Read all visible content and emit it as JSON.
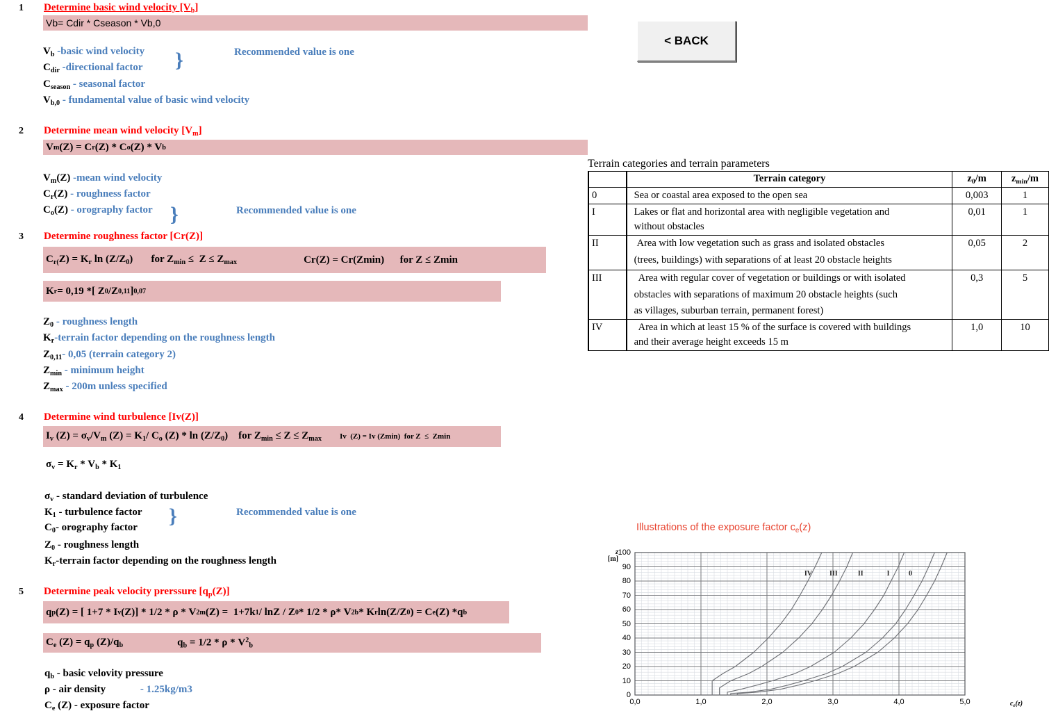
{
  "buttons": {
    "back": "< BACK"
  },
  "steps": [
    {
      "num": "1",
      "heading": "Determine basic wind velocity [Vb]",
      "formula": "Vb= Cdir * Cseason * Vb,0",
      "recommended": "Recommended value is one",
      "defs": [
        {
          "sym": "V",
          "sub": "b",
          "text": "-basic wind velocity"
        },
        {
          "sym": "C",
          "sub": "dir",
          "text": "-directional factor"
        },
        {
          "sym": "C",
          "sub": "season",
          "text": "- seasonal factor"
        },
        {
          "sym": "V",
          "sub": "b,0",
          "text": "- fundamental value of basic wind velocity"
        }
      ]
    },
    {
      "num": "2",
      "heading": "Determine mean wind velocity [Vm]",
      "formula": "Vm(Z) = Cr(Z) * Co(Z) * Vb",
      "recommended": "Recommended value is one",
      "defs": [
        {
          "sym": "V",
          "sub": "m",
          "rest": "(Z)",
          "text": "-mean wind velocity"
        },
        {
          "sym": "C",
          "sub": "r",
          "rest": "(Z)",
          "text": "- roughness factor"
        },
        {
          "sym": "C",
          "sub": "o",
          "rest": "(Z)",
          "text": "- orography factor"
        }
      ]
    },
    {
      "num": "3",
      "heading": "Determine roughness factor [Cr(Z)]",
      "formula_left": "Cr(Z) = Kr ln (Z/Z0)      for Zmin ≤  Z ≤ Zmax",
      "formula_right": "Cr(Z) = Cr(Zmin)      for Z ≤ Zmin",
      "formula2": "Kr = 0,19 *[ Z0/Z0,11]0,07",
      "defs": [
        {
          "sym": "Z",
          "sub": "0",
          "text": "- roughness length"
        },
        {
          "sym": "K",
          "sub": "r",
          "text": "-terrain factor depending on the roughness length"
        },
        {
          "sym": "Z",
          "sub": "0,11",
          "text": "- 0,05 (terrain category  2)"
        },
        {
          "sym": "Z",
          "sub": "min",
          "text": "- minimum height"
        },
        {
          "sym": "Z",
          "sub": "max",
          "text": "- 200m unless specified"
        }
      ]
    },
    {
      "num": "4",
      "heading": "Determine wind turbulence  [Iv(Z)]",
      "formula": "Iv (Z) = σv/Vm (Z) = K1/ Co (Z) * ln (Z/Z0)    for Zmin ≤ Z ≤ Zmax",
      "formula_small": "Iv  (Z) = Iv (Zmin)   for Z  ≤  Zmin",
      "formula2": "σv = Kr * Vb * K1",
      "recommended": "Recommended value is one",
      "defs": [
        {
          "sym": "σ",
          "sub": "v",
          "text": "- standard deviation of turbulence"
        },
        {
          "sym": "K",
          "sub": "1",
          "text": "- turbulence factor"
        },
        {
          "sym": "C",
          "sub": "0",
          "text": "- orography factor"
        },
        {
          "sym": "Z",
          "sub": "0",
          "text": "- roughness length"
        },
        {
          "sym": "K",
          "sub": "r",
          "text": "-terrain factor depending on the roughness length"
        }
      ]
    },
    {
      "num": "5",
      "heading": "Determine peak velocity prerssure [qp(Z)]",
      "formula": "qp (Z) = [ 1+7 * Iv (Z)] * 1/2 * ρ * V2m (Z) =  1+7k1/ lnZ / Z0 * 1/2 * ρ* V2b * Kr ln(Z/Z0) = Ce (Z) *qb",
      "formula2_left": "Ce (Z) = qp (Z)/qb",
      "formula2_right": "qb = 1/2 * ρ * V2b",
      "defs": [
        {
          "sym": "q",
          "sub": "b",
          "text": "- basic velovity pressure"
        },
        {
          "sym": "ρ",
          "sub": "",
          "text": "- air density",
          "value": "- 1.25kg/m3"
        },
        {
          "sym": "C",
          "sub": "e",
          "rest": " (Z)",
          "text": "- exposure factor"
        }
      ]
    }
  ],
  "terrain_table": {
    "title": "Terrain categories and terrain parameters",
    "headers": {
      "blank": "",
      "category": "Terrain category",
      "z0": "z0/m",
      "zmin": "zmin/m"
    },
    "rows": [
      {
        "cat": "0",
        "desc": [
          "Sea or coastal area exposed to the open sea"
        ],
        "z0": "0,003",
        "zmin": "1"
      },
      {
        "cat": "I",
        "desc": [
          "Lakes or flat and horizontal area with negligible vegetation and",
          "without obstacles"
        ],
        "z0": "0,01",
        "zmin": "1"
      },
      {
        "cat": "II",
        "desc": [
          "Area with low vegetation such as grass and isolated obstacles",
          "(trees, buildings) with separations of at least 20 obstacle heights"
        ],
        "z0": "0,05",
        "zmin": "2"
      },
      {
        "cat": "III",
        "desc": [
          "Area with regular cover of vegetation or buildings or with isolated",
          "obstacles with separations of maximum 20 obstacle heights (such",
          "as villages, suburban terrain, permanent forest)"
        ],
        "z0": "0,3",
        "zmin": "5"
      },
      {
        "cat": "IV",
        "desc": [
          "Area in which at least 15 % of the surface is covered with buildings",
          "and their average height exceeds 15 m"
        ],
        "z0": "1,0",
        "zmin": "10"
      }
    ]
  },
  "chart_data": {
    "type": "line",
    "title": "Illustrations of the exposure factor ce(z)",
    "xlabel": "ce(z)",
    "ylabel": "z [m]",
    "xlim": [
      0.0,
      5.0
    ],
    "ylim": [
      0,
      100
    ],
    "xticks": [
      "0,0",
      "1,0",
      "2,0",
      "3,0",
      "4,0",
      "5,0"
    ],
    "yticks": [
      "0",
      "10",
      "20",
      "30",
      "40",
      "50",
      "60",
      "70",
      "80",
      "90",
      "100"
    ],
    "grid": true,
    "legend_position": "inline-at-curve-top",
    "series": [
      {
        "name": "IV",
        "zmin": 10,
        "ce_at_zmin": 1.17,
        "points": [
          [
            1.17,
            0
          ],
          [
            1.17,
            10
          ],
          [
            1.33,
            15
          ],
          [
            1.52,
            20
          ],
          [
            1.8,
            30
          ],
          [
            2.02,
            40
          ],
          [
            2.21,
            50
          ],
          [
            2.37,
            60
          ],
          [
            2.5,
            70
          ],
          [
            2.62,
            80
          ],
          [
            2.73,
            90
          ],
          [
            2.83,
            100
          ]
        ]
      },
      {
        "name": "III",
        "zmin": 5,
        "ce_at_zmin": 1.28,
        "points": [
          [
            1.28,
            0
          ],
          [
            1.28,
            5
          ],
          [
            1.45,
            10
          ],
          [
            1.72,
            15
          ],
          [
            1.92,
            20
          ],
          [
            2.24,
            30
          ],
          [
            2.48,
            40
          ],
          [
            2.68,
            50
          ],
          [
            2.84,
            60
          ],
          [
            2.98,
            70
          ],
          [
            3.1,
            80
          ],
          [
            3.21,
            90
          ],
          [
            3.3,
            100
          ]
        ]
      },
      {
        "name": "II",
        "zmin": 2,
        "ce_at_zmin": 1.4,
        "points": [
          [
            1.4,
            0
          ],
          [
            1.4,
            2
          ],
          [
            1.6,
            4
          ],
          [
            1.85,
            7
          ],
          [
            2.08,
            10
          ],
          [
            2.42,
            15
          ],
          [
            2.66,
            20
          ],
          [
            3.02,
            30
          ],
          [
            3.27,
            40
          ],
          [
            3.47,
            50
          ],
          [
            3.63,
            60
          ],
          [
            3.77,
            70
          ],
          [
            3.88,
            80
          ],
          [
            3.99,
            90
          ],
          [
            4.08,
            100
          ]
        ]
      },
      {
        "name": "I",
        "zmin": 1,
        "ce_at_zmin": 1.45,
        "points": [
          [
            1.45,
            0
          ],
          [
            1.45,
            1
          ],
          [
            1.72,
            2
          ],
          [
            2.05,
            4
          ],
          [
            2.32,
            7
          ],
          [
            2.55,
            10
          ],
          [
            2.9,
            15
          ],
          [
            3.14,
            20
          ],
          [
            3.5,
            30
          ],
          [
            3.75,
            40
          ],
          [
            3.95,
            50
          ],
          [
            4.1,
            60
          ],
          [
            4.23,
            70
          ],
          [
            4.35,
            80
          ],
          [
            4.45,
            90
          ],
          [
            4.54,
            100
          ]
        ]
      },
      {
        "name": "0",
        "zmin": 1,
        "ce_at_zmin": 1.55,
        "points": [
          [
            1.55,
            0
          ],
          [
            1.55,
            1
          ],
          [
            1.85,
            2
          ],
          [
            2.2,
            4
          ],
          [
            2.48,
            7
          ],
          [
            2.72,
            10
          ],
          [
            3.07,
            15
          ],
          [
            3.32,
            20
          ],
          [
            3.68,
            30
          ],
          [
            3.93,
            40
          ],
          [
            4.13,
            50
          ],
          [
            4.29,
            60
          ],
          [
            4.42,
            70
          ],
          [
            4.54,
            80
          ],
          [
            4.64,
            90
          ],
          [
            4.73,
            100
          ]
        ]
      }
    ],
    "curve_labels": [
      {
        "name": "IV",
        "x": 2.62,
        "y": 85
      },
      {
        "name": "III",
        "x": 3.0,
        "y": 85
      },
      {
        "name": "II",
        "x": 3.43,
        "y": 85
      },
      {
        "name": "I",
        "x": 3.87,
        "y": 85
      },
      {
        "name": "0",
        "x": 4.2,
        "y": 85
      }
    ]
  }
}
